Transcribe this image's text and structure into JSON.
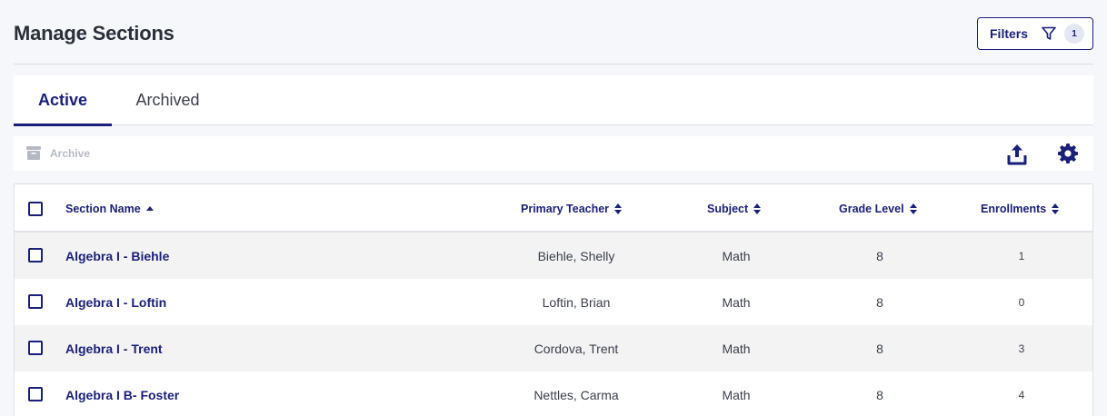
{
  "page": {
    "title": "Manage Sections"
  },
  "filters": {
    "label": "Filters",
    "count": "1",
    "icon": "filter-icon"
  },
  "tabs": [
    {
      "label": "Active",
      "active": true
    },
    {
      "label": "Archived",
      "active": false
    }
  ],
  "toolbar": {
    "archive_label": "Archive",
    "archive_icon": "archive-icon",
    "upload_icon": "upload-icon",
    "settings_icon": "gear-icon"
  },
  "table": {
    "columns": {
      "section_name": "Section Name",
      "primary_teacher": "Primary Teacher",
      "subject": "Subject",
      "grade_level": "Grade Level",
      "enrollments": "Enrollments"
    },
    "sort": {
      "column": "Section Name",
      "direction": "ascending"
    },
    "rows": [
      {
        "name": "Algebra I - Biehle",
        "teacher": "Biehle, Shelly",
        "subject": "Math",
        "grade": "8",
        "enrollments": "1"
      },
      {
        "name": "Algebra I - Loftin",
        "teacher": "Loftin, Brian",
        "subject": "Math",
        "grade": "8",
        "enrollments": "0"
      },
      {
        "name": "Algebra I - Trent",
        "teacher": "Cordova, Trent",
        "subject": "Math",
        "grade": "8",
        "enrollments": "3"
      },
      {
        "name": "Algebra I B- Foster",
        "teacher": "Nettles, Carma",
        "subject": "Math",
        "grade": "8",
        "enrollments": "4"
      }
    ]
  },
  "colors": {
    "primary": "#1a1f7a",
    "background": "#f6f7fb",
    "disabled": "#b5b9c3",
    "row_stripe": "#f3f3f4"
  }
}
